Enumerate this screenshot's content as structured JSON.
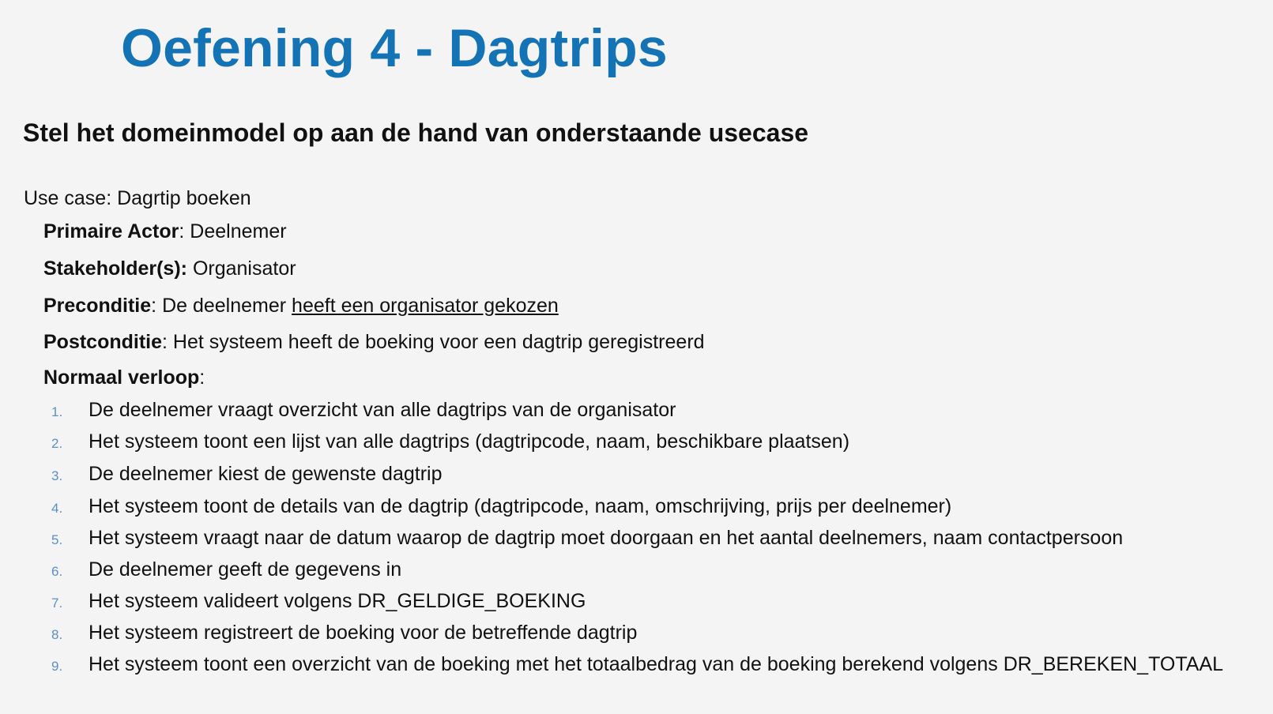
{
  "title": "Oefening 4 - Dagtrips",
  "subtitle": "Stel het domeinmodel op aan de hand van onderstaande usecase",
  "use_case": "Use case: Dagrtip boeken",
  "fields": {
    "primary_actor": {
      "label": "Primaire Actor",
      "sep": ": ",
      "value": "Deelnemer"
    },
    "stakeholders": {
      "label": "Stakeholder(s):",
      "sep": " ",
      "value": "Organisator"
    },
    "precondition": {
      "label": "Preconditie",
      "sep": ": ",
      "value_prefix": "De deelnemer ",
      "value_underlined": "heeft een organisator gekozen"
    },
    "postcondition": {
      "label": "Postconditie",
      "sep": ": ",
      "value": "Het systeem heeft de boeking voor een dagtrip geregistreerd"
    },
    "normal_flow": {
      "label": "Normaal verloop",
      "sep": ":"
    }
  },
  "steps": [
    {
      "num": "1.",
      "text": "De deelnemer vraagt overzicht van alle dagtrips van de organisator"
    },
    {
      "num": "2.",
      "text": "Het systeem toont een lijst van alle dagtrips (dagtripcode, naam,  beschikbare plaatsen)"
    },
    {
      "num": "3.",
      "text": "De deelnemer kiest de gewenste dagtrip"
    },
    {
      "num": "4.",
      "text": "Het systeem toont de details van de dagtrip (dagtripcode, naam, omschrijving,  prijs per deelnemer)"
    },
    {
      "num": "5.",
      "text": "Het systeem vraagt naar de datum waarop de dagtrip moet doorgaan en het aantal deelnemers, naam contactpersoon"
    },
    {
      "num": "6.",
      "text": "De deelnemer geeft de gegevens in"
    },
    {
      "num": "7.",
      "text": "Het systeem valideert volgens DR_GELDIGE_BOEKING"
    },
    {
      "num": "8.",
      "text": "Het systeem registreert de boeking voor de betreffende dagtrip"
    },
    {
      "num": "9.",
      "text": "Het systeem toont een overzicht van de boeking met het totaalbedrag van de boeking berekend volgens DR_BEREKEN_TOTAAL"
    }
  ],
  "colors": {
    "title": "#1473b4",
    "step_number": "#5b8fc9",
    "background": "#f4f4f4"
  }
}
